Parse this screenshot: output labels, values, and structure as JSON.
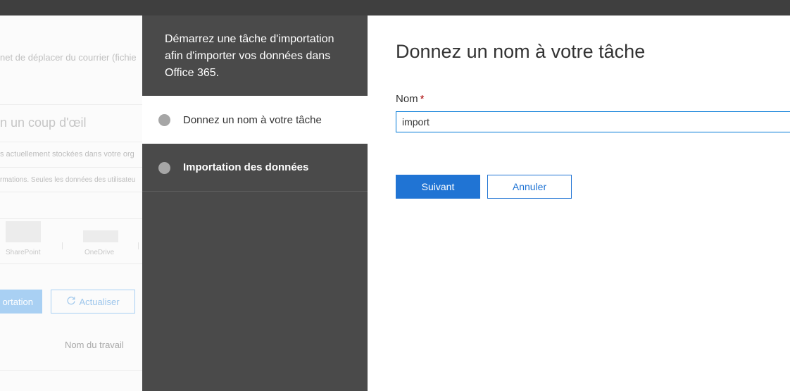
{
  "background_page": {
    "description": "net de déplacer du courrier (fichie",
    "heading": "n un coup d'œil",
    "line1": "s actuellement stockées dans votre org",
    "line2": "rmations. Seules les données des utilisateu",
    "chart_labels": [
      "SharePoint",
      "OneDrive"
    ],
    "import_button": "ortation",
    "refresh_button": "Actualiser",
    "refresh_icon": "refresh-icon",
    "column_header": "Nom du travail"
  },
  "wizard": {
    "intro": "Démarrez une tâche d'importation afin d'importer vos données dans Office 365.",
    "steps": [
      {
        "label": "Donnez un nom à votre tâche",
        "state": "active"
      },
      {
        "label": "Importation des données",
        "state": "inactive"
      }
    ]
  },
  "form": {
    "title": "Donnez un nom à votre tâche",
    "name_label": "Nom",
    "required_marker": "*",
    "name_value": "import",
    "next_button": "Suivant",
    "cancel_button": "Annuler"
  }
}
